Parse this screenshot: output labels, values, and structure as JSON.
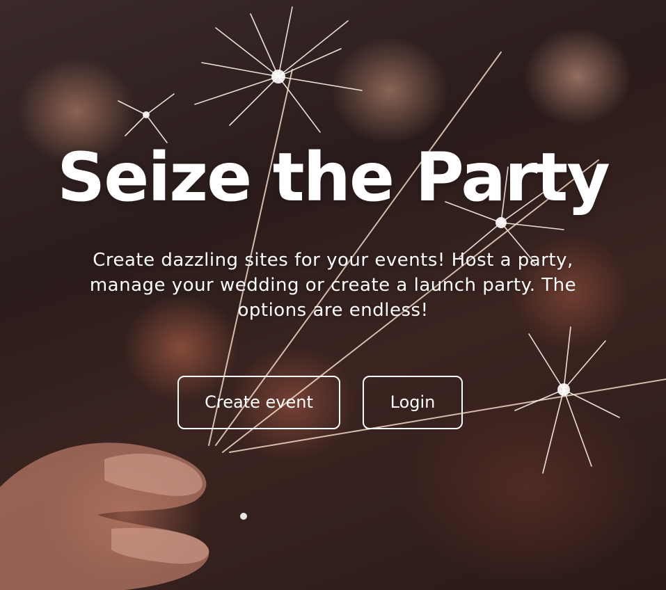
{
  "hero": {
    "title": "Seize the Party",
    "subtitle": "Create dazzling sites for your events! Host a party, manage your wedding or create a launch party. The options are endless!"
  },
  "actions": {
    "create_event_label": "Create event",
    "login_label": "Login"
  },
  "colors": {
    "text": "#ffffff",
    "button_border": "#ffffff",
    "background_dark": "#2a1c1b",
    "bokeh_warm": "#d69678"
  }
}
